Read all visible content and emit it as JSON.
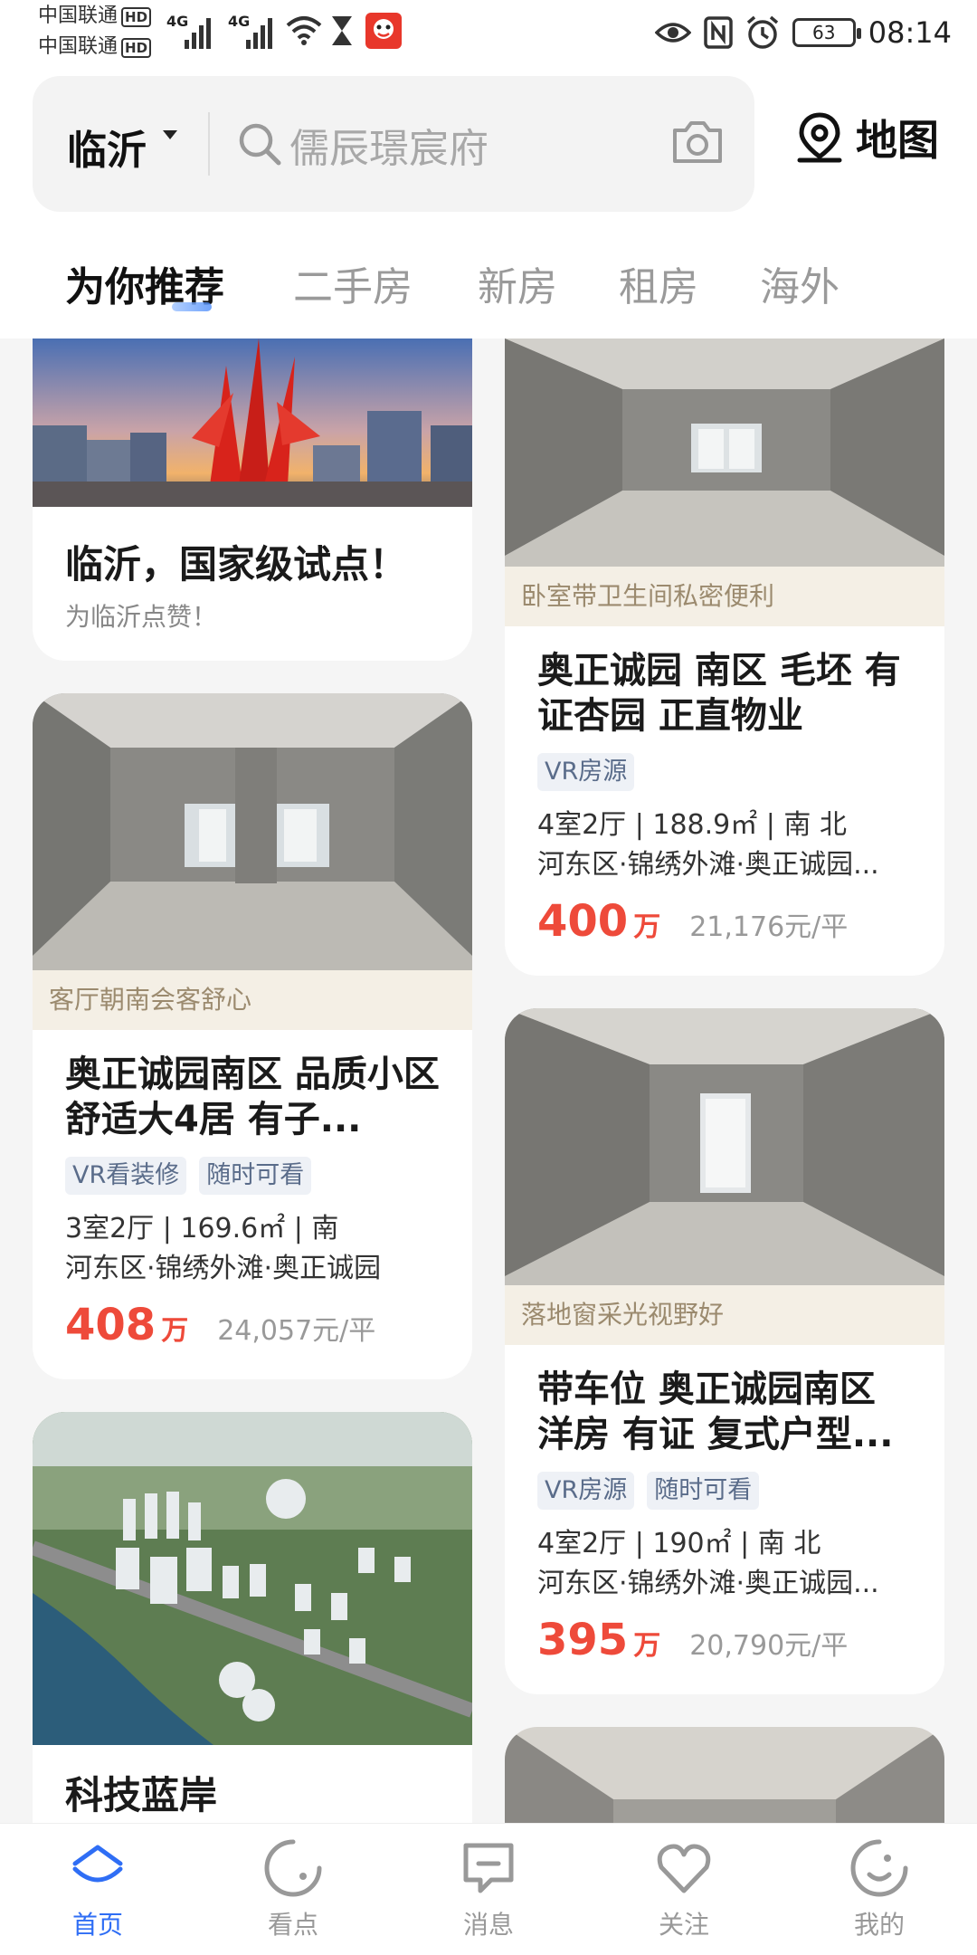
{
  "status_bar": {
    "carrier_1": "中国联通",
    "carrier_2": "中国联通",
    "hd_badge": "HD",
    "network_1": "4G",
    "network_2": "4G",
    "battery": "63",
    "time": "08:14"
  },
  "search": {
    "city": "临沂",
    "placeholder": "儒辰璟宸府",
    "map_label": "地图"
  },
  "tabs": [
    {
      "label": "为你推荐"
    },
    {
      "label": "二手房"
    },
    {
      "label": "新房"
    },
    {
      "label": "租房"
    },
    {
      "label": "海外"
    }
  ],
  "promo": {
    "title": "临沂，国家级试点！",
    "subtitle": "为临沂点赞！"
  },
  "listings": [
    {
      "caption": "卧室带卫生间私密便利",
      "title": "奥正诚园 南区 毛坯 有证杏园 正直物业",
      "tags": [
        "VR房源"
      ],
      "layout": "4室2厅 | 188.9㎡ | 南 北",
      "location": "河东区·锦绣外滩·奥正诚园...",
      "price": "400",
      "price_unit": "万",
      "unit_price": "21,176元/平"
    },
    {
      "caption": "客厅朝南会客舒心",
      "title": "奥正诚园南区 品质小区 舒适大4居 有子...",
      "tags": [
        "VR看装修",
        "随时可看"
      ],
      "layout": "3室2厅 | 169.6㎡ | 南",
      "location": "河东区·锦绣外滩·奥正诚园",
      "price": "408",
      "price_unit": "万",
      "unit_price": "24,057元/平"
    },
    {
      "caption": "落地窗采光视野好",
      "title": "带车位 奥正诚园南区 洋房 有证 复式户型...",
      "tags": [
        "VR房源",
        "随时可看"
      ],
      "layout": "4室2厅 | 190㎡ | 南 北",
      "location": "河东区·锦绣外滩·奥正诚园...",
      "price": "395",
      "price_unit": "万",
      "unit_price": "20,790元/平"
    }
  ],
  "project": {
    "title": "科技蓝岸"
  },
  "bottom_nav": [
    {
      "label": "首页"
    },
    {
      "label": "看点"
    },
    {
      "label": "消息"
    },
    {
      "label": "关注"
    },
    {
      "label": "我的"
    }
  ],
  "colors": {
    "accent_blue": "#2f6ef5",
    "price_red": "#ee4a3a",
    "caption_bg": "#f4efe5",
    "caption_text": "#9b8a6e"
  }
}
